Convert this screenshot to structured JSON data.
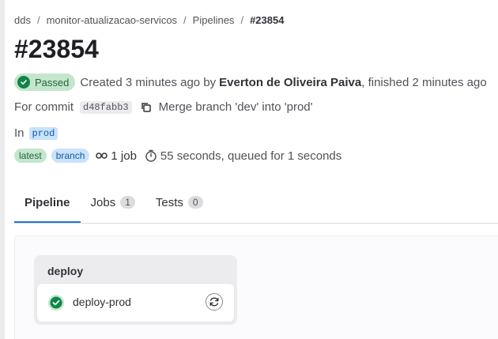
{
  "breadcrumb": {
    "items": [
      "dds",
      "monitor-atualizacao-servicos",
      "Pipelines",
      "#23854"
    ],
    "separator": "/"
  },
  "page_title": "#23854",
  "status": {
    "badge_label": "Passed",
    "created_text": "Created 3 minutes ago by",
    "author": "Everton de Oliveira Paiva",
    "finished_text": ", finished 2 minutes ago"
  },
  "commit": {
    "prefix": "For commit",
    "sha": "d48fabb3",
    "message": "Merge branch 'dev' into 'prod'"
  },
  "ref": {
    "prefix": "In",
    "branch": "prod"
  },
  "meta": {
    "latest_label": "latest",
    "branch_label": "branch",
    "jobs_label": "1 job",
    "duration_text": "55 seconds, queued for 1 seconds"
  },
  "tabs": [
    {
      "label": "Pipeline",
      "count": ""
    },
    {
      "label": "Jobs",
      "count": "1"
    },
    {
      "label": "Tests",
      "count": "0"
    }
  ],
  "graph": {
    "stage_name": "deploy",
    "job_name": "deploy-prod"
  },
  "colors": {
    "success": "#108548",
    "accent": "#1f75cb"
  },
  "icons": {
    "status": "check-circle-icon",
    "copy": "copy-icon",
    "jobs": "pipeline-icon",
    "duration": "timer-icon",
    "retry": "retry-icon"
  }
}
